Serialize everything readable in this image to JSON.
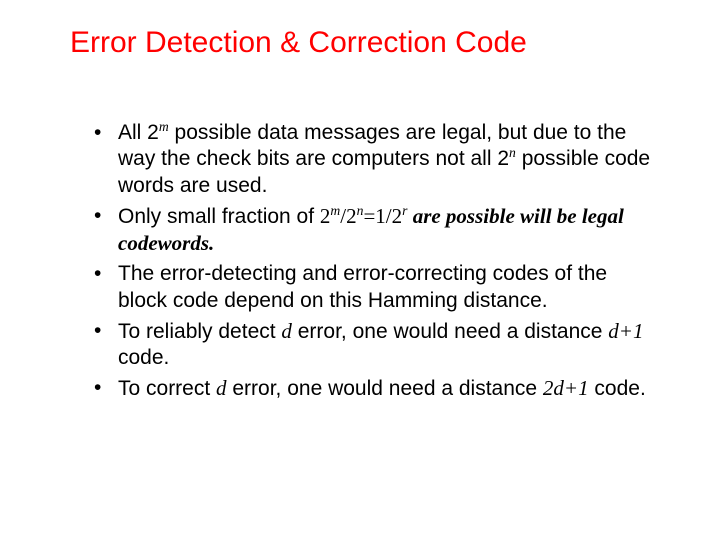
{
  "title": "Error Detection & Correction Code",
  "bullets": {
    "b1": {
      "t1": "All 2",
      "e1": "m",
      "t2": " possible data messages are legal, but due to the way the check bits are computers not all 2",
      "e2": "n",
      "t3": " possible code words are used."
    },
    "b2": {
      "t1": "Only small fraction of ",
      "f1a": "2",
      "f1e": "m",
      "f2": "/2",
      "f2e": "n",
      "f3": "=1/2",
      "f3e": "r",
      "t2": " are possible will be legal codewords."
    },
    "b3": "The error-detecting and error-correcting codes of the block code depend on this Hamming distance.",
    "b4": {
      "t1": "To reliably detect ",
      "d": "d",
      "t2": " error, one would need a distance ",
      "dp1": "d+1",
      "t3": " code."
    },
    "b5": {
      "t1": "To correct ",
      "d": "d",
      "t2": " error, one would need a distance ",
      "dp1": "2d+1",
      "t3": " code."
    }
  }
}
